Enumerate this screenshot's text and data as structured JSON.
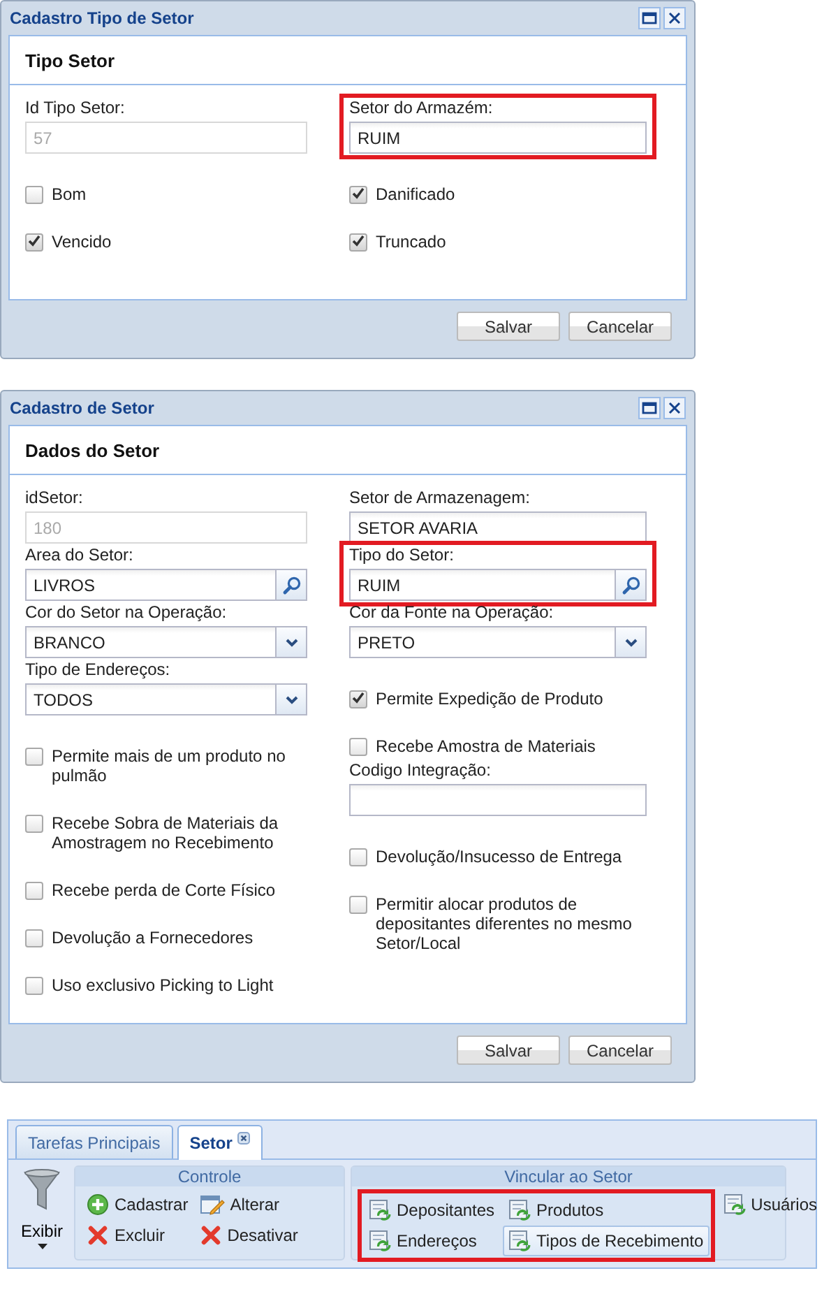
{
  "windows": [
    {
      "title": "Cadastro Tipo de Setor",
      "section": "Tipo Setor",
      "min_rows": true,
      "columns": [
        [
          {
            "kind": "field",
            "label": "Id Tipo Setor:",
            "value": "57",
            "disabled": true,
            "highlighted": false
          },
          {
            "kind": "checkbox",
            "label": "Bom",
            "checked": false
          },
          {
            "kind": "checkbox",
            "label": "Vencido",
            "checked": true
          }
        ],
        [
          {
            "kind": "field",
            "label": "Setor do Armazém:",
            "value": "RUIM",
            "disabled": false,
            "highlighted": true
          },
          {
            "kind": "checkbox",
            "label": "Danificado",
            "checked": true
          },
          {
            "kind": "checkbox",
            "label": "Truncado",
            "checked": true
          }
        ]
      ],
      "buttons": [
        "Salvar",
        "Cancelar"
      ]
    },
    {
      "title": "Cadastro de Setor",
      "section": "Dados do Setor",
      "min_rows": false,
      "columns": [
        [
          {
            "kind": "field",
            "label": "idSetor:",
            "value": "180",
            "disabled": true,
            "highlighted": false
          },
          {
            "kind": "lookup",
            "label": "Area do Setor:",
            "value": "LIVROS",
            "disabled": false,
            "highlighted": false
          },
          {
            "kind": "select",
            "label": "Cor do Setor na Operação:",
            "value": "BRANCO",
            "disabled": false,
            "highlighted": false
          },
          {
            "kind": "select",
            "label": "Tipo de Endereços:",
            "value": "TODOS",
            "disabled": false,
            "highlighted": false
          },
          {
            "kind": "checkbox",
            "label": "Permite mais de um produto no pulmão",
            "checked": false
          },
          {
            "kind": "checkbox",
            "label": "Recebe Sobra de Materiais da Amostragem no Recebimento",
            "checked": false
          },
          {
            "kind": "checkbox",
            "label": "Recebe perda de Corte Físico",
            "checked": false
          },
          {
            "kind": "checkbox",
            "label": "Devolução a Fornecedores",
            "checked": false
          },
          {
            "kind": "checkbox",
            "label": "Uso exclusivo Picking to Light",
            "checked": false
          }
        ],
        [
          {
            "kind": "field",
            "label": "Setor de Armazenagem:",
            "value": "SETOR AVARIA",
            "disabled": false,
            "highlighted": false
          },
          {
            "kind": "lookup",
            "label": "Tipo do Setor:",
            "value": "RUIM",
            "disabled": false,
            "highlighted": true
          },
          {
            "kind": "select",
            "label": "Cor da Fonte na Operação:",
            "value": "PRETO",
            "disabled": false,
            "highlighted": false
          },
          {
            "kind": "checkbox",
            "label": "Permite Expedição de Produto",
            "checked": true
          },
          {
            "kind": "checkbox",
            "label": "Recebe Amostra de Materiais",
            "checked": false
          },
          {
            "kind": "field",
            "label": "Codigo Integração:",
            "disabled": false,
            "highlighted": false
          },
          {
            "kind": "checkbox",
            "label": "Devolução/Insucesso de Entrega",
            "checked": false
          },
          {
            "kind": "checkbox",
            "label": "Permitir alocar produtos de depositantes diferentes no mesmo Setor/Local",
            "checked": false
          }
        ]
      ],
      "buttons": [
        "Salvar",
        "Cancelar"
      ]
    }
  ],
  "toolbar": {
    "tabs": [
      {
        "label": "Tarefas Principais",
        "selected": false,
        "closable": false
      },
      {
        "label": "Setor",
        "selected": true,
        "closable": true
      }
    ],
    "view_button": "Exibir",
    "groups": [
      {
        "title": "Controle",
        "items": [
          {
            "label": "Cadastrar",
            "kind": "add",
            "selected": false,
            "highlighted": false
          },
          {
            "label": "Alterar",
            "kind": "edit",
            "selected": false,
            "highlighted": false
          },
          {
            "label": "Excluir",
            "kind": "delete",
            "selected": false,
            "highlighted": false
          },
          {
            "label": "Desativar",
            "kind": "delete",
            "selected": false,
            "highlighted": false
          }
        ]
      },
      {
        "title": "Vincular ao Setor",
        "items": [
          {
            "label": "Depositantes",
            "kind": "link",
            "selected": false,
            "highlighted": true
          },
          {
            "label": "Produtos",
            "kind": "link",
            "selected": false,
            "highlighted": true
          },
          {
            "label": "Usuários",
            "kind": "link",
            "selected": false,
            "highlighted": false
          },
          {
            "label": "Endereços",
            "kind": "link",
            "selected": false,
            "highlighted": true
          },
          {
            "label": "Tipos de Recebimento",
            "kind": "link",
            "selected": true,
            "highlighted": true
          }
        ]
      }
    ]
  }
}
